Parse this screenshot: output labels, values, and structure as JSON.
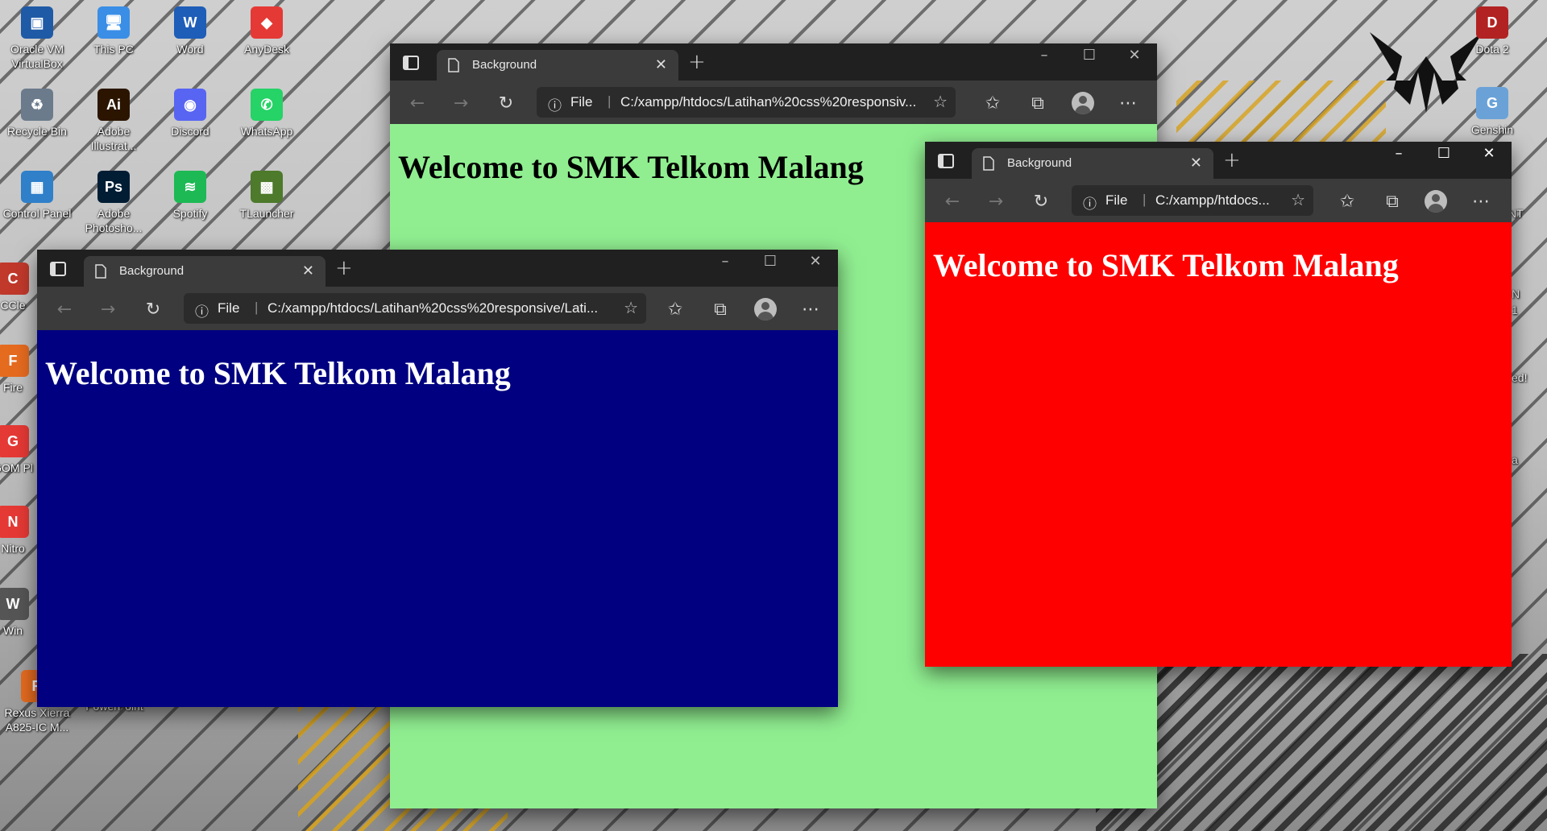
{
  "desktop": {
    "icons_left": [
      {
        "label": "Oracle VM VirtualBox",
        "glyph": "▣",
        "color": "#1f5aa6"
      },
      {
        "label": "This PC",
        "glyph": "🖥",
        "color": "#3a8ee6"
      },
      {
        "label": "Word",
        "glyph": "W",
        "color": "#1e5db8"
      },
      {
        "label": "AnyDesk",
        "glyph": "◆",
        "color": "#e53935"
      },
      {
        "label": "Recycle Bin",
        "glyph": "♻",
        "color": "#6b7b8c"
      },
      {
        "label": "Adobe Illustrat...",
        "glyph": "Ai",
        "color": "#2b1500"
      },
      {
        "label": "Discord",
        "glyph": "◉",
        "color": "#5865f2"
      },
      {
        "label": "WhatsApp",
        "glyph": "✆",
        "color": "#25d366"
      },
      {
        "label": "Control Panel",
        "glyph": "▦",
        "color": "#2f80c9"
      },
      {
        "label": "Adobe Photosho...",
        "glyph": "Ps",
        "color": "#001d34"
      },
      {
        "label": "Spotify",
        "glyph": "≋",
        "color": "#1db954"
      },
      {
        "label": "TLauncher",
        "glyph": "▩",
        "color": "#4d7a2b"
      },
      {
        "label": "CCle",
        "glyph": "C",
        "color": "#c0392b"
      },
      {
        "label": "Fire",
        "glyph": "F",
        "color": "#e56b1f"
      },
      {
        "label": "GOM Pl",
        "glyph": "G",
        "color": "#e53935"
      },
      {
        "label": "Nitro",
        "glyph": "N",
        "color": "#e53935"
      },
      {
        "label": "Win",
        "glyph": "W",
        "color": "#555"
      },
      {
        "label": "Rexus Xierra A825-IC M...",
        "glyph": "R",
        "color": "#e56b1f"
      }
    ],
    "partial_label_powerpoint": "PowerPoint",
    "icons_right": [
      {
        "label": "Dota 2",
        "glyph": "D",
        "color": "#b22222"
      },
      {
        "label": "Genshin",
        "glyph": "G",
        "color": "#6aa2d8"
      }
    ],
    "right_partial_labels": [
      "NT",
      "N",
      "1",
      "ed!",
      "a"
    ]
  },
  "windows": {
    "green": {
      "tab_title": "Background",
      "address_scheme": "File",
      "address_url": "C:/xampp/htdocs/Latihan%20css%20responsiv...",
      "heading": "Welcome to SMK Telkom Malang",
      "bg_color": "#90ee90",
      "text_color": "#000000"
    },
    "blue": {
      "tab_title": "Background",
      "address_scheme": "File",
      "address_url": "C:/xampp/htdocs/Latihan%20css%20responsive/Lati...",
      "heading": "Welcome to SMK Telkom Malang",
      "bg_color": "#000080",
      "text_color": "#ffffff"
    },
    "red": {
      "tab_title": "Background",
      "address_scheme": "File",
      "address_url": "C:/xampp/htdocs...",
      "heading": "Welcome to SMK Telkom Malang",
      "bg_color": "#ff0000",
      "text_color": "#ffffff"
    }
  },
  "icons": {
    "tab_actions": "tab-actions-icon",
    "document": "page-icon",
    "close": "close-icon",
    "new_tab": "plus-icon",
    "back": "arrow-left-icon",
    "forward": "arrow-right-icon",
    "refresh": "refresh-icon",
    "info": "info-icon",
    "add_favorite": "star-plus-icon",
    "favorites": "favorites-icon",
    "collections": "collections-icon",
    "profile": "avatar",
    "more": "more-icon"
  }
}
